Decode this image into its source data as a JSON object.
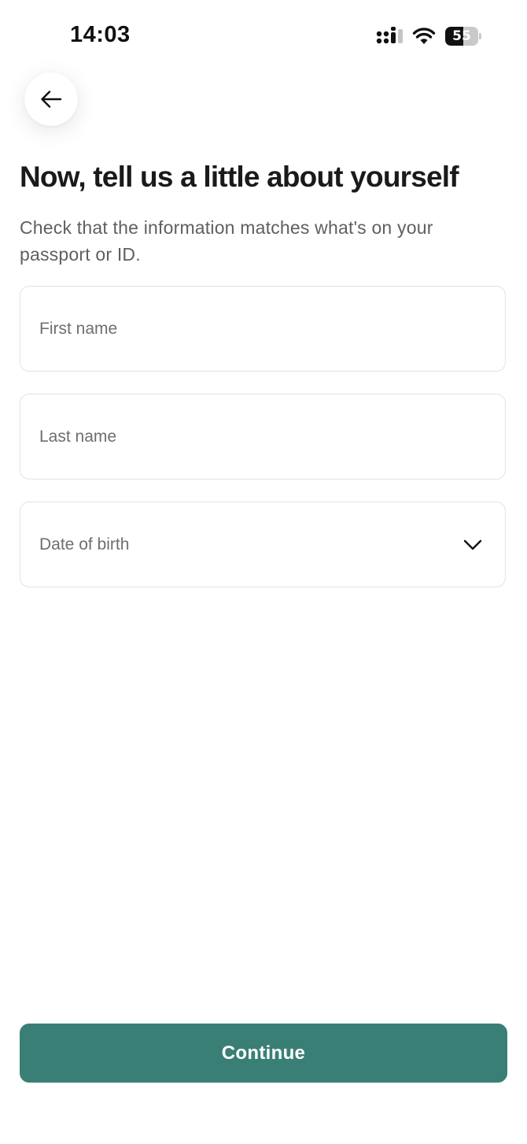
{
  "status_bar": {
    "time": "14:03",
    "battery_level": "55",
    "icons": [
      "signal-icon",
      "wifi-icon",
      "battery-icon"
    ]
  },
  "back_icon": "arrow-left-icon",
  "title": "Now, tell us a little about yourself",
  "subtitle": "Check that the information matches what's on your passport or ID.",
  "fields": {
    "first_name": {
      "placeholder": "First name",
      "value": ""
    },
    "last_name": {
      "placeholder": "Last name",
      "value": ""
    },
    "date_of_birth": {
      "label": "Date of birth",
      "icon": "chevron-down-icon"
    }
  },
  "continue_label": "Continue",
  "colors": {
    "accent": "#3a7f75",
    "title": "#1a1a1a",
    "subtitle": "#5f5f5f",
    "field_border": "#e3e3e3"
  }
}
